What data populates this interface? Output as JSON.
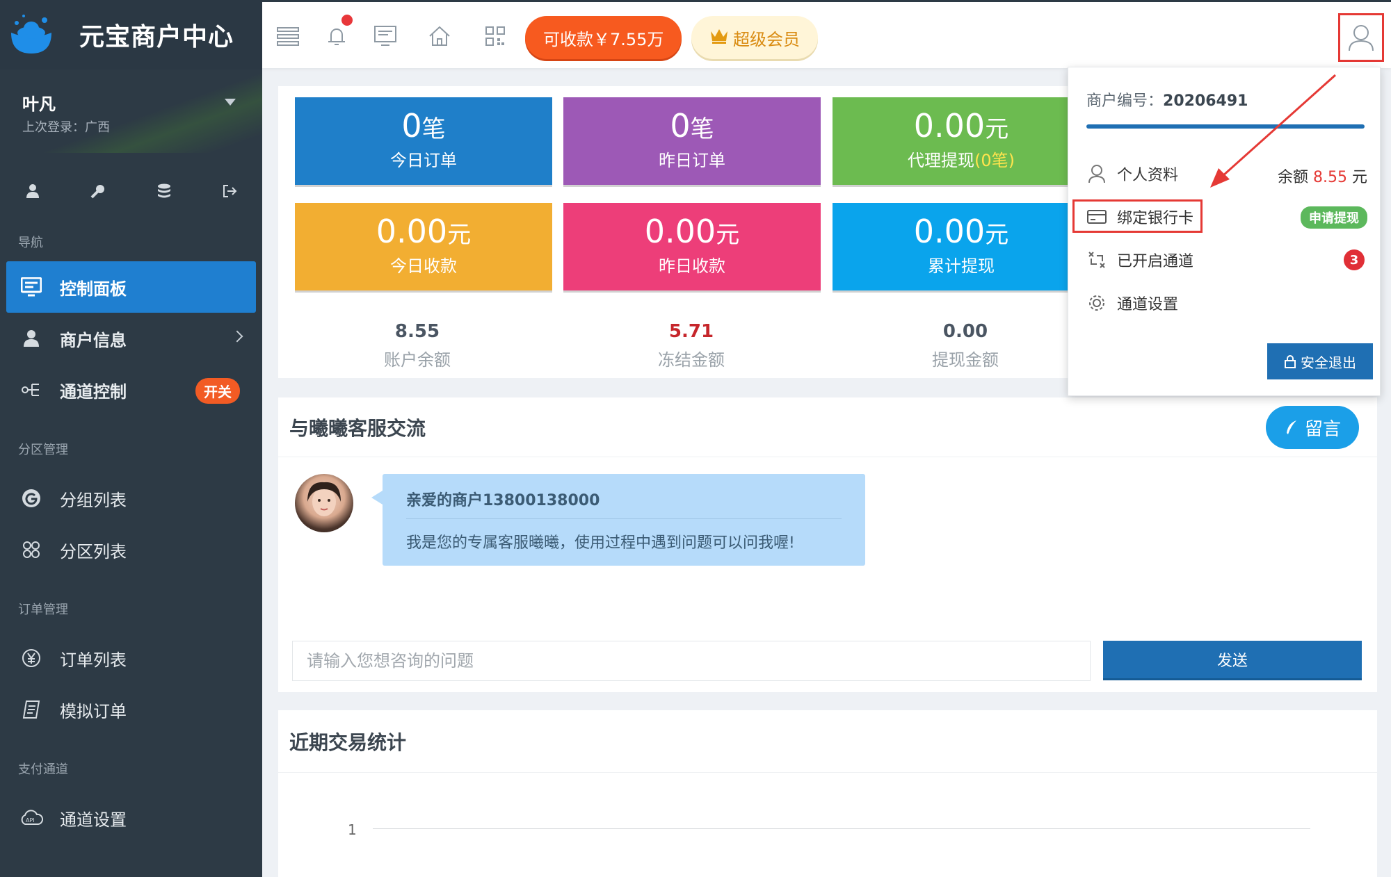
{
  "brand": {
    "title": "元宝商户中心"
  },
  "user": {
    "name": "叶凡",
    "last_login": "上次登录：广西"
  },
  "sidebar": {
    "sections": [
      {
        "title": "导航",
        "items": [
          {
            "label": "控制面板",
            "icon": "monitor-icon",
            "active": true
          },
          {
            "label": "商户信息",
            "icon": "user-icon",
            "chevron": true
          },
          {
            "label": "通道控制",
            "icon": "sitemap-icon",
            "badge": "开关"
          }
        ]
      },
      {
        "title": "分区管理",
        "items": [
          {
            "label": "分组列表",
            "icon": "google-icon"
          },
          {
            "label": "分区列表",
            "icon": "grid-circle-icon"
          }
        ]
      },
      {
        "title": "订单管理",
        "items": [
          {
            "label": "订单列表",
            "icon": "yen-icon"
          },
          {
            "label": "模拟订单",
            "icon": "receipt-icon"
          }
        ]
      },
      {
        "title": "支付通道",
        "items": [
          {
            "label": "通道设置",
            "icon": "api-cloud-icon"
          }
        ]
      }
    ]
  },
  "topbar": {
    "receivable": "可收款￥7.55万",
    "vip": "超级会员"
  },
  "tiles": [
    {
      "value": "0",
      "unit": "笔",
      "label": "今日订单",
      "color": "blue"
    },
    {
      "value": "0",
      "unit": "笔",
      "label": "昨日订单",
      "color": "purple"
    },
    {
      "value": "0.00",
      "unit": "元",
      "label": "代理提现",
      "label_extra": "(0笔)",
      "color": "green"
    },
    {
      "value": "0.00",
      "unit": "元",
      "label": "今日收款",
      "color": "orange"
    },
    {
      "value": "0.00",
      "unit": "元",
      "label": "昨日收款",
      "color": "pink"
    },
    {
      "value": "0.00",
      "unit": "元",
      "label": "累计提现",
      "color": "cyan"
    }
  ],
  "balances": [
    {
      "value": "8.55",
      "label": "账户余额"
    },
    {
      "value": "5.71",
      "label": "冻结金额"
    },
    {
      "value": "0.00",
      "label": "提现金额"
    }
  ],
  "chat": {
    "title": "与曦曦客服交流",
    "leave_msg": "留言",
    "greeting": "亲爱的商户13800138000",
    "message": "我是您的专属客服曦曦，使用过程中遇到问题可以问我喔!",
    "input_placeholder": "请输入您想咨询的问题",
    "send": "发送"
  },
  "trend": {
    "title": "近期交易统计",
    "y_tick": "1"
  },
  "dropdown": {
    "merchant_label": "商户编号：",
    "merchant_id": "20206491",
    "items": [
      {
        "label": "个人资料",
        "right_prefix": "余额 ",
        "right_value": "8.55",
        "right_suffix": " 元"
      },
      {
        "label": "绑定银行卡",
        "badge": "申请提现"
      },
      {
        "label": "已开启通道",
        "count": "3"
      },
      {
        "label": "通道设置"
      }
    ],
    "logout": "安全退出"
  }
}
